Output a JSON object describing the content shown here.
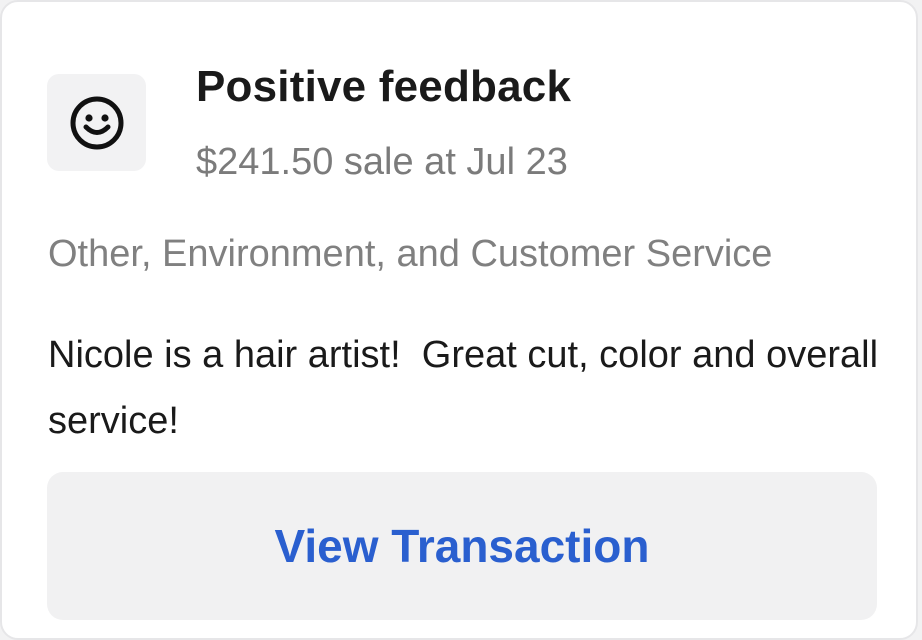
{
  "feedback": {
    "icon": "smiley-face-icon",
    "title": "Positive feedback",
    "subtitle": "$241.50 sale at Jul 23",
    "categories": "Other, Environment, and Customer Service",
    "comment": "Nicole is a hair artist!  Great cut, color and overall service!",
    "view_transaction_label": "View Transaction"
  },
  "colors": {
    "link_blue": "#2a5fcf",
    "muted_text": "#7b7b7b",
    "tile_background": "#f2f2f3"
  }
}
